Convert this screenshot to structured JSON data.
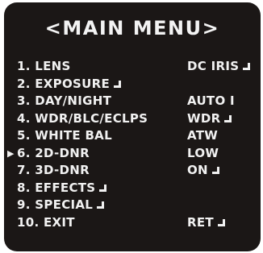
{
  "title": "<MAIN MENU>",
  "cursor": "▶",
  "items": [
    {
      "label": "1. LENS",
      "value": "DC IRIS",
      "label_enter": false,
      "value_enter": true,
      "selected": false
    },
    {
      "label": "2. EXPOSURE",
      "value": "",
      "label_enter": true,
      "value_enter": false,
      "selected": false
    },
    {
      "label": "3. DAY/NIGHT",
      "value": "AUTO I",
      "label_enter": false,
      "value_enter": false,
      "selected": false
    },
    {
      "label": "4. WDR/BLC/ECLPS",
      "value": "WDR",
      "label_enter": false,
      "value_enter": true,
      "selected": false
    },
    {
      "label": "5. WHITE BAL",
      "value": "ATW",
      "label_enter": false,
      "value_enter": false,
      "selected": false
    },
    {
      "label": "6. 2D-DNR",
      "value": "LOW",
      "label_enter": false,
      "value_enter": false,
      "selected": true
    },
    {
      "label": "7. 3D-DNR",
      "value": "ON",
      "label_enter": false,
      "value_enter": true,
      "selected": false
    },
    {
      "label": "8. EFFECTS",
      "value": "",
      "label_enter": true,
      "value_enter": false,
      "selected": false
    },
    {
      "label": "9. SPECIAL",
      "value": "",
      "label_enter": true,
      "value_enter": false,
      "selected": false
    },
    {
      "label": "10. EXIT",
      "value": "RET",
      "label_enter": false,
      "value_enter": true,
      "selected": false
    }
  ]
}
